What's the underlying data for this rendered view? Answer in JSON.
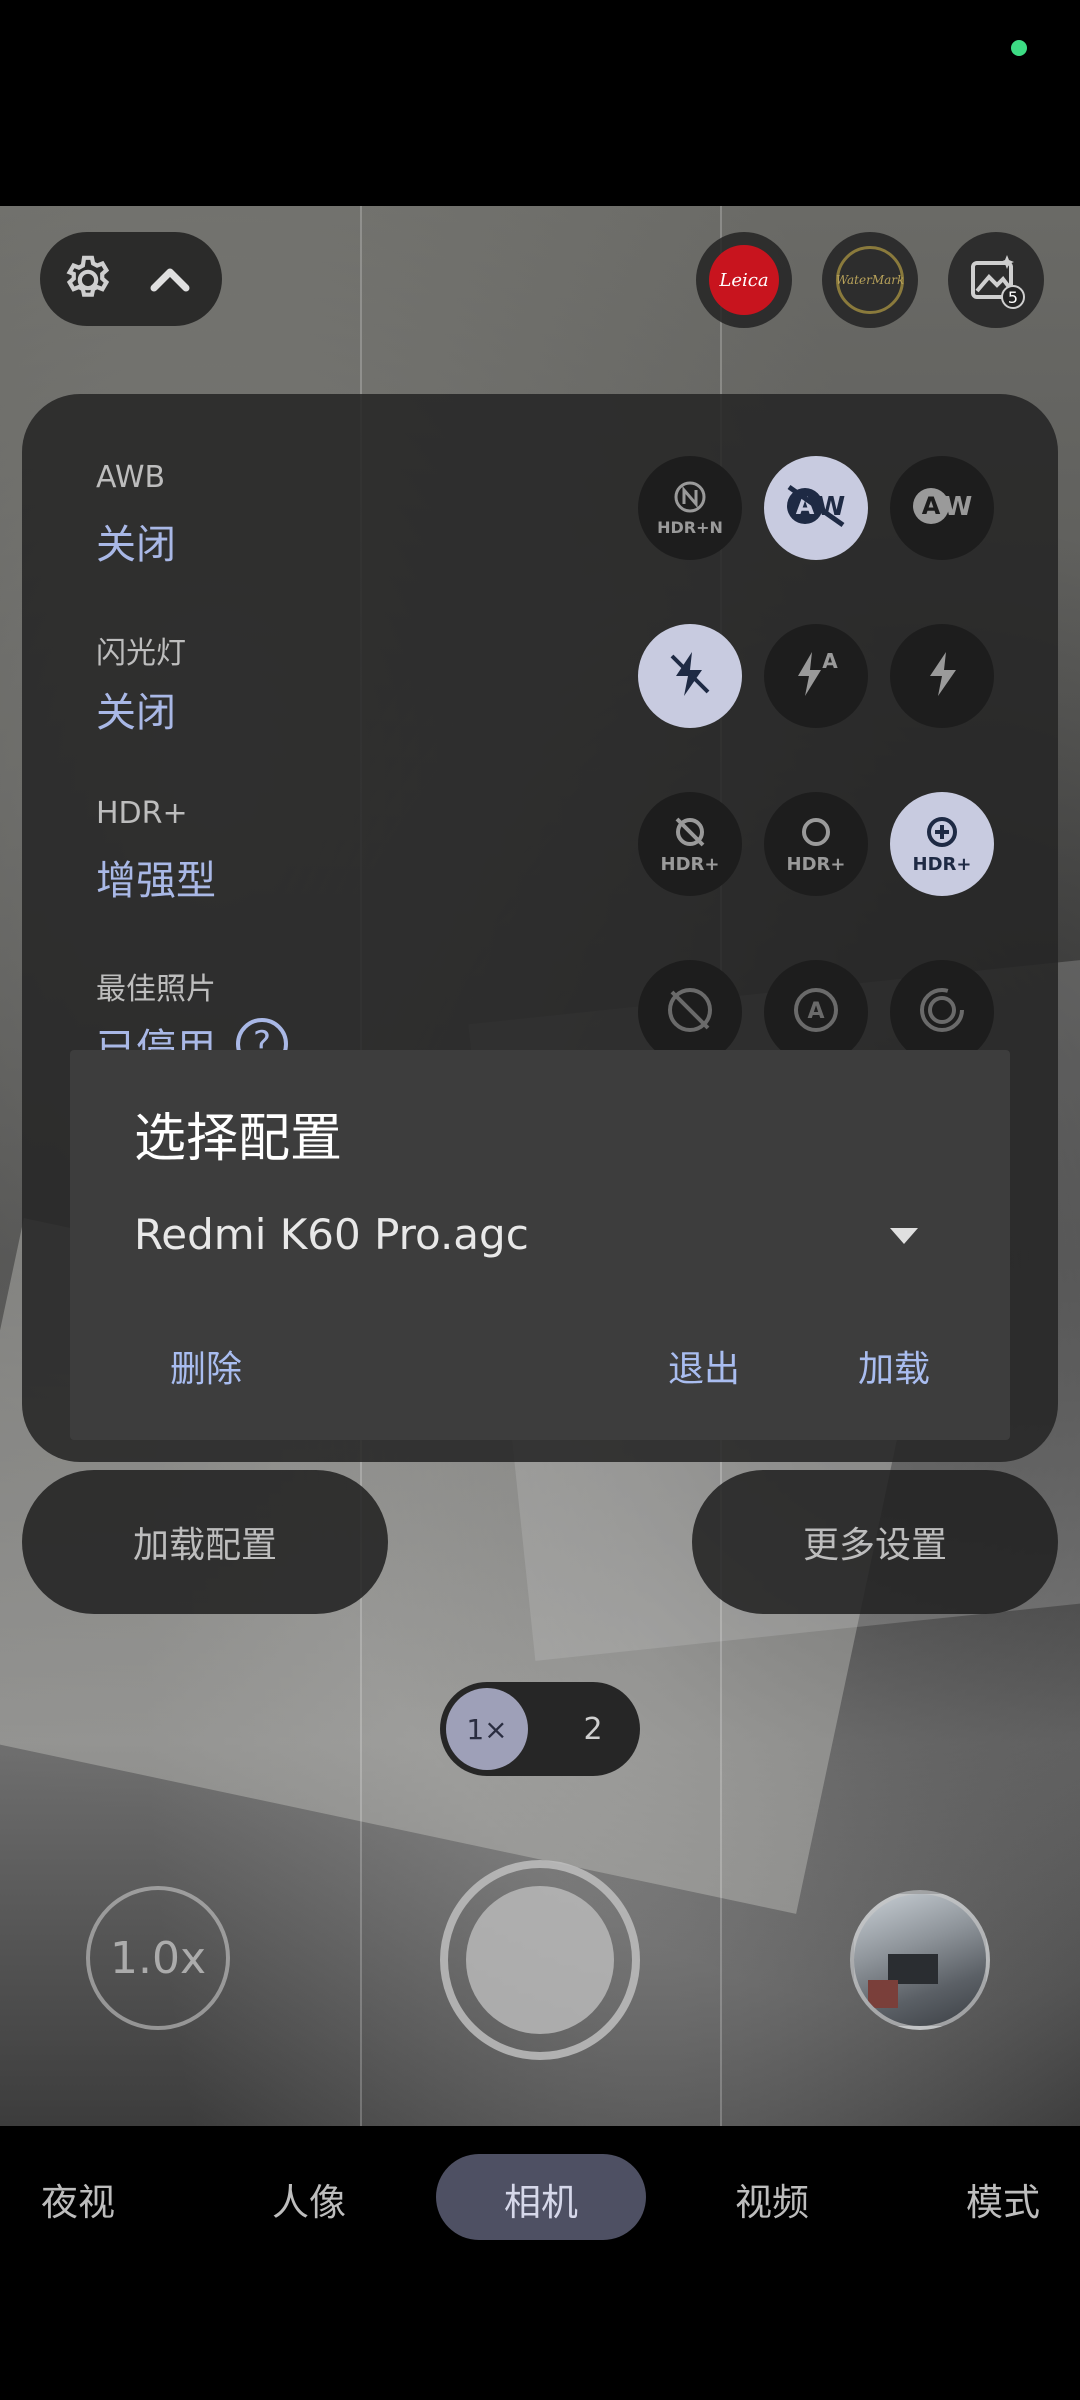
{
  "top_controls": {
    "settings_icon": "gear-icon",
    "collapse_icon": "chevron-up-icon",
    "leica_label": "Leica",
    "watermark_label": "WaterMark",
    "gallery_icon": "image-counter-icon",
    "gallery_count": "5"
  },
  "quick_settings": {
    "awb": {
      "label": "AWB",
      "value": "关闭",
      "options": [
        "HDR+N"
      ]
    },
    "flash": {
      "label": "闪光灯",
      "value": "关闭"
    },
    "hdr": {
      "label": "HDR+",
      "value": "增强型",
      "options": [
        "HDR+",
        "HDR+",
        "HDR+"
      ]
    },
    "best_photo": {
      "label": "最佳照片",
      "value": "已停用"
    }
  },
  "dialog": {
    "title": "选择配置",
    "selected_config": "Redmi K60 Pro.agc",
    "delete_label": "删除",
    "exit_label": "退出",
    "load_label": "加载"
  },
  "actions": {
    "load_config": "加载配置",
    "more_settings": "更多设置"
  },
  "zoom": {
    "option_1": "1×",
    "option_2": "2",
    "lens_zoom": "1.0x"
  },
  "modes": [
    "夜视",
    "人像",
    "相机",
    "视频",
    "模式"
  ],
  "active_mode": "相机",
  "colors": {
    "accent_text": "#a9bdf0",
    "selected_option": "#c8cbe0",
    "status_dot": "#3ddc84",
    "leica_red": "#c8141e"
  }
}
